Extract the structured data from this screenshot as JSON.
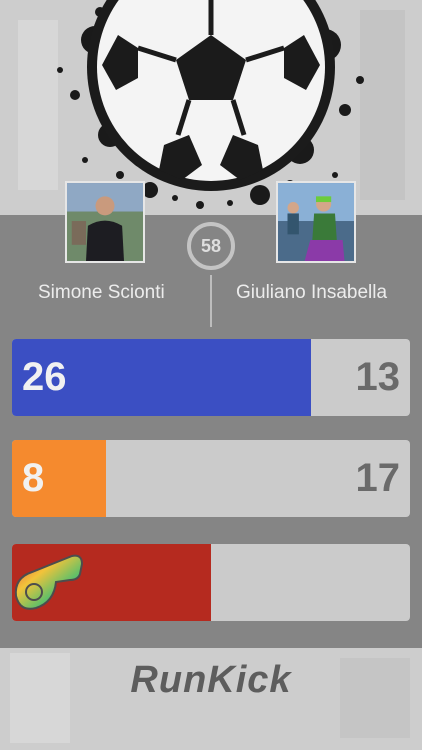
{
  "app": {
    "logo_text": "RunKick"
  },
  "match": {
    "timer_value": "58",
    "player_left": {
      "name": "Simone Scionti",
      "avatar_icon": "player-photo"
    },
    "player_right": {
      "name": "Giuliano Insabella",
      "avatar_icon": "player-photo"
    }
  },
  "stats": [
    {
      "left_value": "26",
      "right_value": "13",
      "fill_fraction": 0.75,
      "fill_color": "#3b4fc3"
    },
    {
      "left_value": "8",
      "right_value": "17",
      "fill_fraction": 0.235,
      "fill_color": "#f58a2e"
    },
    {
      "left_value": "",
      "right_value": "",
      "fill_fraction": 0.5,
      "fill_color": "#b52a1f",
      "icon": "whistle-icon"
    }
  ],
  "colors": {
    "top_background": "#cfcfcf",
    "middle_background": "#858585",
    "empty_bar": "#cbcbcb"
  }
}
